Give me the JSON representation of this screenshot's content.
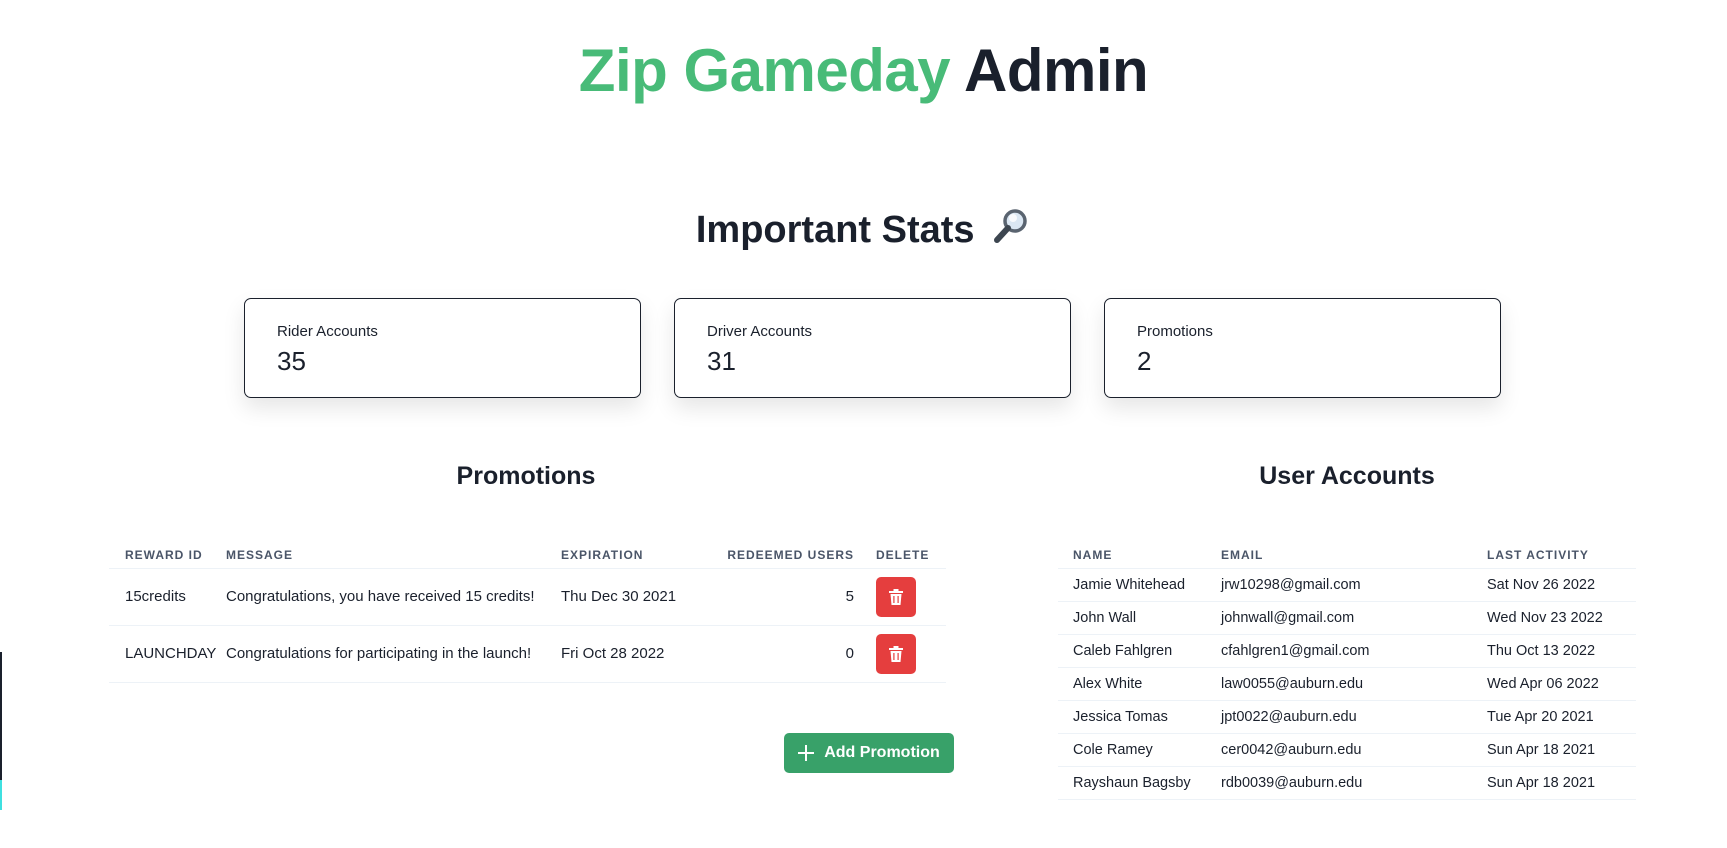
{
  "header": {
    "brand": "Zip Gameday",
    "suffix": "Admin"
  },
  "stats": {
    "heading": "Important Stats",
    "cards": [
      {
        "label": "Rider Accounts",
        "value": "35"
      },
      {
        "label": "Driver Accounts",
        "value": "31"
      },
      {
        "label": "Promotions",
        "value": "2"
      }
    ]
  },
  "promotions": {
    "title": "Promotions",
    "columns": [
      "REWARD ID",
      "MESSAGE",
      "EXPIRATION",
      "REDEEMED USERS",
      "DELETE"
    ],
    "rows": [
      {
        "reward_id": "15credits",
        "message": "Congratulations, you have received 15 credits!",
        "expiration": "Thu Dec 30 2021",
        "redeemed": "5"
      },
      {
        "reward_id": "LAUNCHDAY",
        "message": "Congratulations for participating in the launch!",
        "expiration": "Fri Oct 28 2022",
        "redeemed": "0"
      }
    ],
    "add_label": "Add Promotion"
  },
  "users": {
    "title": "User Accounts",
    "columns": [
      "NAME",
      "EMAIL",
      "LAST ACTIVITY"
    ],
    "rows": [
      {
        "name": "Jamie Whitehead",
        "email": "jrw10298@gmail.com",
        "last": "Sat Nov 26 2022"
      },
      {
        "name": "John Wall",
        "email": "johnwall@gmail.com",
        "last": "Wed Nov 23 2022"
      },
      {
        "name": "Caleb Fahlgren",
        "email": "cfahlgren1@gmail.com",
        "last": "Thu Oct 13 2022"
      },
      {
        "name": "Alex White",
        "email": "law0055@auburn.edu",
        "last": "Wed Apr 06 2022"
      },
      {
        "name": "Jessica Tomas",
        "email": "jpt0022@auburn.edu",
        "last": "Tue Apr 20 2021"
      },
      {
        "name": "Cole Ramey",
        "email": "cer0042@auburn.edu",
        "last": "Sun Apr 18 2021"
      },
      {
        "name": "Rayshaun Bagsby",
        "email": "rdb0039@auburn.edu",
        "last": "Sun Apr 18 2021"
      }
    ]
  },
  "colors": {
    "brand": "#48bb78",
    "danger": "#e53e3e",
    "primary_button": "#38a169"
  },
  "icons": {
    "stats": "magnifying-glass-icon",
    "delete": "trash-icon",
    "add": "plus-icon"
  }
}
